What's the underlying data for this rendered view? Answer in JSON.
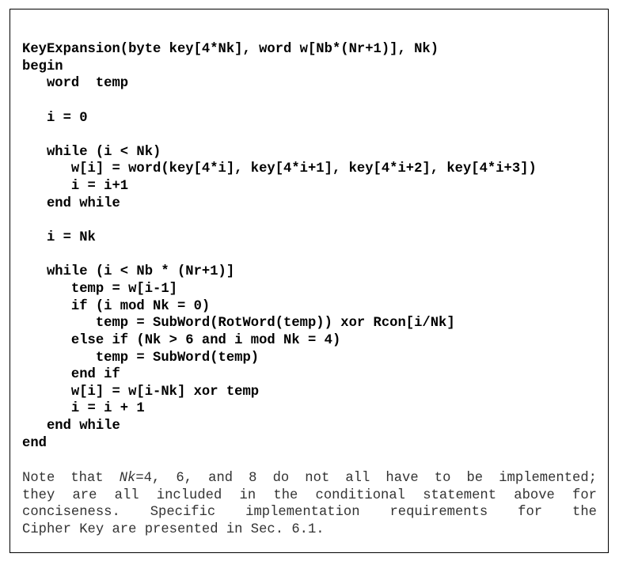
{
  "document": {
    "code_lines": [
      "KeyExpansion(byte key[4*Nk], word w[Nb*(Nr+1)], Nk)",
      "begin",
      "   word  temp",
      "",
      "   i = 0",
      "",
      "   while (i < Nk)",
      "      w[i] = word(key[4*i], key[4*i+1], key[4*i+2], key[4*i+3])",
      "      i = i+1",
      "   end while",
      "",
      "   i = Nk",
      "",
      "   while (i < Nb * (Nr+1)]",
      "      temp = w[i-1]",
      "      if (i mod Nk = 0)",
      "         temp = SubWord(RotWord(temp)) xor Rcon[i/Nk]",
      "      else if (Nk > 6 and i mod Nk = 4)",
      "         temp = SubWord(temp)",
      "      end if",
      "      w[i] = w[i-Nk] xor temp",
      "      i = i + 1",
      "   end while",
      "end"
    ],
    "note": {
      "line1_prefix": "Note that ",
      "line1_italic": "Nk",
      "line1_suffix": "=4, 6, and 8 do not all have to be implemented;",
      "line2": "they are all included in the conditional statement above for",
      "line3": "conciseness.  Specific implementation requirements for the",
      "line4": "Cipher Key are presented in Sec. 6.1."
    }
  }
}
